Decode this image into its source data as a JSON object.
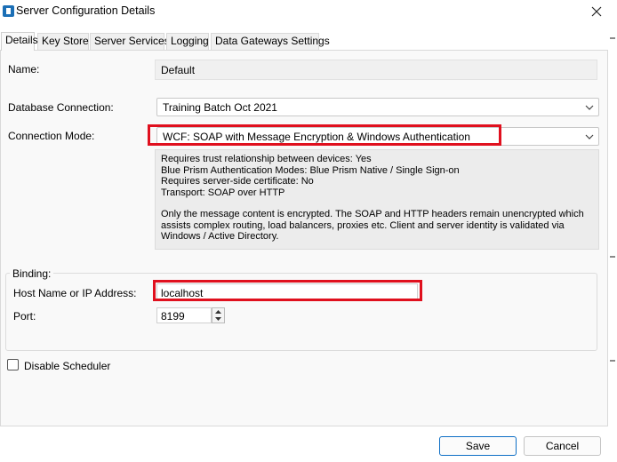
{
  "window": {
    "title": "Server Configuration Details",
    "icon": "blue-prism-app-icon",
    "close_icon": "close-icon"
  },
  "tabs": [
    {
      "label": "Details",
      "active": true
    },
    {
      "label": "Key Store",
      "active": false
    },
    {
      "label": "Server Services",
      "active": false
    },
    {
      "label": "Logging",
      "active": false
    },
    {
      "label": "Data Gateways Settings",
      "active": false
    }
  ],
  "form": {
    "name_label": "Name:",
    "name_value": "Default",
    "db_label": "Database Connection:",
    "db_value": "Training Batch Oct 2021",
    "mode_label": "Connection Mode:",
    "mode_value": "WCF: SOAP with Message Encryption & Windows Authentication",
    "mode_description": {
      "lines": [
        "Requires trust relationship between devices: Yes",
        "Blue Prism Authentication Modes: Blue Prism Native / Single Sign-on",
        "Requires server-side certificate: No",
        "Transport: SOAP over HTTP"
      ],
      "paragraph": "Only the message content is encrypted. The SOAP and HTTP headers remain unencrypted which assists complex routing, load balancers, proxies etc. Client and server identity is validated via Windows / Active Directory."
    },
    "binding": {
      "title": "Binding:",
      "host_label": "Host Name or IP Address:",
      "host_value": "localhost",
      "port_label": "Port:",
      "port_value": "8199"
    },
    "disable_scheduler_label": "Disable Scheduler",
    "disable_scheduler_checked": false
  },
  "buttons": {
    "save": "Save",
    "cancel": "Cancel"
  },
  "colors": {
    "highlight": "#e0101e",
    "accent": "#0e6fc5"
  }
}
